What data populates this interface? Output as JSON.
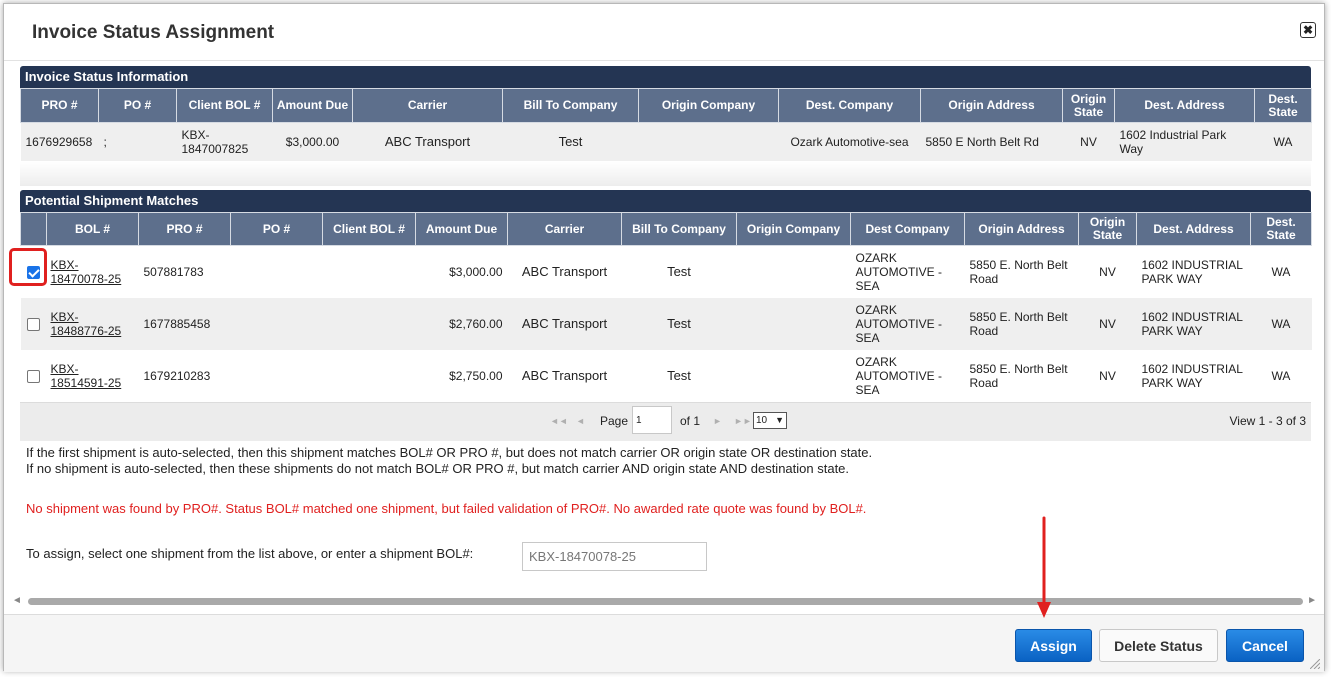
{
  "dialog": {
    "title": "Invoice Status Assignment",
    "close_icon": "✖"
  },
  "invoice_section": {
    "title": "Invoice Status Information",
    "headers": [
      "PRO #",
      "PO #",
      "Client BOL #",
      "Amount Due",
      "Carrier",
      "Bill To Company",
      "Origin Company",
      "Dest. Company",
      "Origin Address",
      "Origin State",
      "Dest. Address",
      "Dest. State"
    ],
    "row": {
      "pro": "1676929658",
      "po": ";",
      "client_bol": "KBX-1847007825",
      "amount_due": "$3,000.00",
      "carrier": "ABC Transport",
      "bill_to": "Test",
      "origin_company": "",
      "dest_company": "Ozark Automotive-sea",
      "origin_address": "5850 E North Belt Rd",
      "origin_state": "NV",
      "dest_address": "1602 Industrial Park Way",
      "dest_state": "WA"
    }
  },
  "matches_section": {
    "title": "Potential Shipment Matches",
    "headers": [
      "BOL #",
      "PRO #",
      "PO #",
      "Client BOL #",
      "Amount Due",
      "Carrier",
      "Bill To Company",
      "Origin Company",
      "Dest Company",
      "Origin Address",
      "Origin State",
      "Dest. Address",
      "Dest. State"
    ],
    "rows": [
      {
        "checked": true,
        "bol": "KBX-18470078-25",
        "pro": "507881783",
        "po": "",
        "client_bol": "",
        "amount_due": "$3,000.00",
        "carrier": "ABC Transport",
        "bill_to": "Test",
        "origin_company": "",
        "dest_company": "OZARK AUTOMOTIVE - SEA",
        "origin_address": "5850 E. North Belt Road",
        "origin_state": "NV",
        "dest_address": "1602 INDUSTRIAL PARK WAY",
        "dest_state": "WA"
      },
      {
        "checked": false,
        "bol": "KBX-18488776-25",
        "pro": "1677885458",
        "po": "",
        "client_bol": "",
        "amount_due": "$2,760.00",
        "carrier": "ABC Transport",
        "bill_to": "Test",
        "origin_company": "",
        "dest_company": "OZARK AUTOMOTIVE - SEA",
        "origin_address": "5850 E. North Belt Road",
        "origin_state": "NV",
        "dest_address": "1602 INDUSTRIAL PARK WAY",
        "dest_state": "WA"
      },
      {
        "checked": false,
        "bol": "KBX-18514591-25",
        "pro": "1679210283",
        "po": "",
        "client_bol": "",
        "amount_due": "$2,750.00",
        "carrier": "ABC Transport",
        "bill_to": "Test",
        "origin_company": "",
        "dest_company": "OZARK AUTOMOTIVE - SEA",
        "origin_address": "5850 E. North Belt Road",
        "origin_state": "NV",
        "dest_address": "1602 INDUSTRIAL PARK WAY",
        "dest_state": "WA"
      }
    ]
  },
  "pager": {
    "first_icon": "◄◄",
    "prev_icon": "◄",
    "next_icon": "►",
    "last_icon": "►►",
    "page_label": "Page",
    "page_value": "1",
    "of_label": "of 1",
    "rows_per_page": "10",
    "view_text": "View 1 - 3 of 3"
  },
  "notes": {
    "line1": "If the first shipment is auto-selected, then this shipment matches BOL# OR PRO #, but does not match carrier OR origin state OR destination state.",
    "line2": "If no shipment is auto-selected, then these shipments do not match BOL# OR PRO #, but match carrier AND origin state AND destination state.",
    "error": "No shipment was found by PRO#. Status BOL# matched one shipment, but failed validation of PRO#. No awarded rate quote was found by BOL#.",
    "assign_prompt": "To assign, select one shipment from the list above, or enter a shipment BOL#:",
    "bol_input_value": "KBX-18470078-25"
  },
  "footer": {
    "assign_label": "Assign",
    "delete_label": "Delete Status",
    "cancel_label": "Cancel"
  },
  "colors": {
    "section_bar": "#243553",
    "header_bg": "#5d6f8c",
    "primary_button": "#0a62c3",
    "error_text": "#e0201f",
    "annotation_red": "#e0201f"
  }
}
